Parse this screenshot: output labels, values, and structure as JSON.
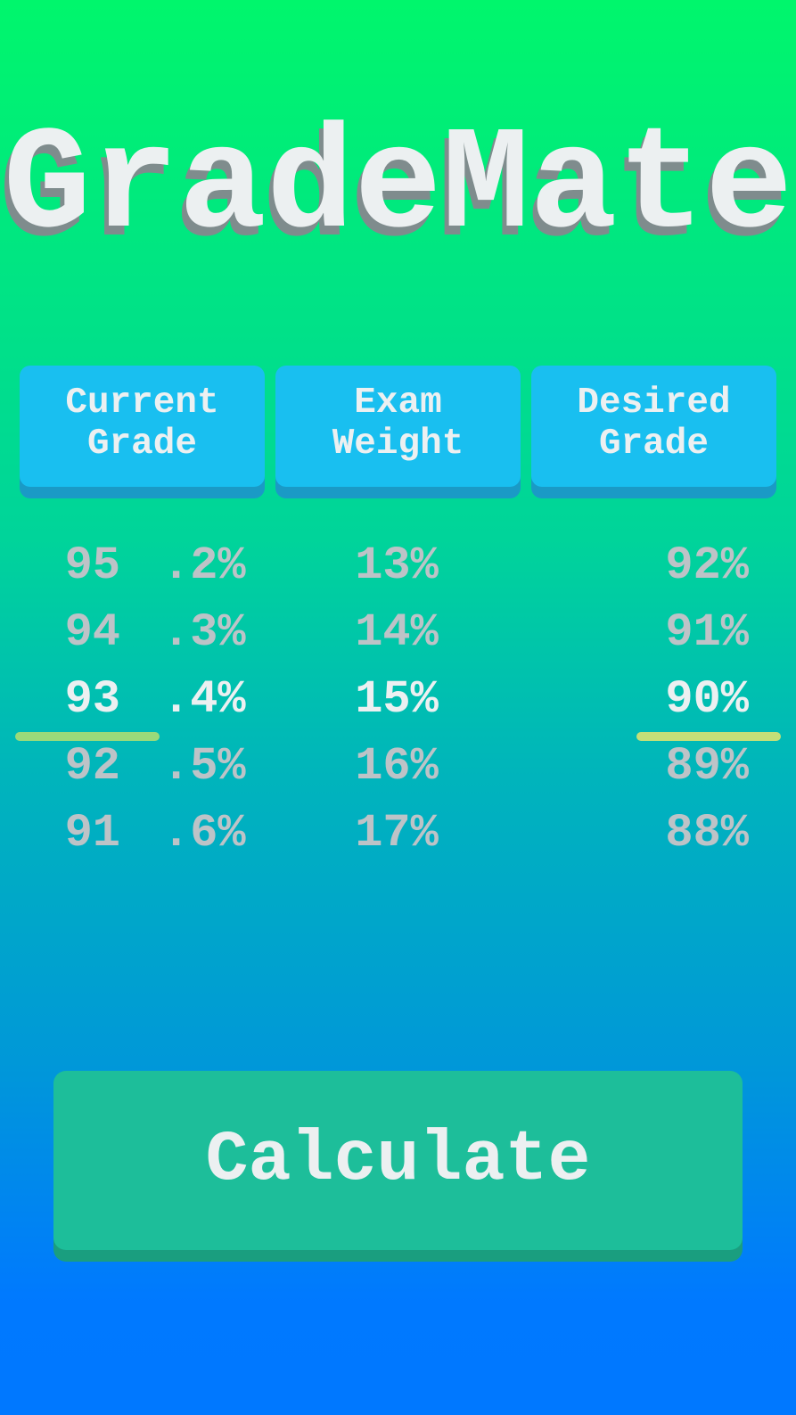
{
  "app": {
    "title": "GradeMate"
  },
  "headers": [
    {
      "label": "Current\nGrade"
    },
    {
      "label": "Exam\nWeight"
    },
    {
      "label": "Desired\nGrade"
    }
  ],
  "current_grade": {
    "whole": [
      "95",
      "94",
      "93",
      "92",
      "91"
    ],
    "decimal": [
      ".2%",
      ".3%",
      ".4%",
      ".5%",
      ".6%"
    ],
    "selected_whole": "93",
    "selected_decimal": ".4%"
  },
  "exam_weight": {
    "options": [
      "13%",
      "14%",
      "15%",
      "16%",
      "17%"
    ],
    "selected": "15%"
  },
  "desired_grade": {
    "options": [
      "92%",
      "91%",
      "90%",
      "89%",
      "88%"
    ],
    "selected": "90%"
  },
  "calculate_label": "Calculate",
  "colors": {
    "header_button": "#19bff0",
    "calculate_button": "#1dbe9a",
    "selection_line_left": "#9ada7a",
    "selection_line_right": "#c4df78",
    "unselected_text": "#bdc3c7",
    "selected_text": "#ecf0f1"
  }
}
